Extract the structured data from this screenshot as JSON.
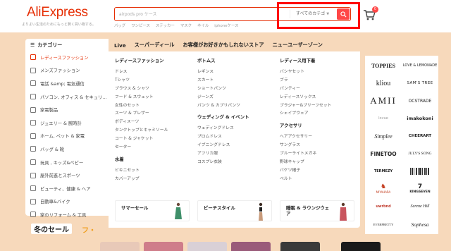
{
  "brand": {
    "logo": "AliExpress",
    "tagline": "よりよい生活のためにもっと賢く買い物する。"
  },
  "search": {
    "placeholder": "airpods pro ケース",
    "category": "すべてのカテゴ",
    "quick_links": [
      "バッグ",
      "ワンピース",
      "ステッカー",
      "マスク",
      "ネイル",
      "iphoneケース"
    ]
  },
  "cart": {
    "count": "0"
  },
  "sidebar": {
    "heading": "カテゴリー",
    "items": [
      {
        "label": "レディースファッション",
        "active": true
      },
      {
        "label": "メンズファッション"
      },
      {
        "label": "電話 &amp; 電気通信"
      },
      {
        "label": "パソコン, オフィス & セキュリ..."
      },
      {
        "label": "家電製品"
      },
      {
        "label": "ジュエリー & 腕時計"
      },
      {
        "label": "ホーム, ペット & 家電"
      },
      {
        "label": "バッグ & 靴"
      },
      {
        "label": "玩具 , キッズ&ベビー"
      },
      {
        "label": "屋外前進とスポーツ"
      },
      {
        "label": "ビューティ、健康 & ヘア"
      },
      {
        "label": "自動車&バイク"
      },
      {
        "label": "家のリフォーム & 工具"
      }
    ]
  },
  "topnav": [
    "Live",
    "スーパーディール",
    "お客様がお好きかもしれないストア",
    "ニューユーザーゾーン"
  ],
  "columns": [
    {
      "sections": [
        {
          "title": "レディースファッション",
          "links": [
            "ドレス",
            "Tシャツ",
            "ブラウス & シャツ",
            "フード & スウェット",
            "女性のセット",
            "スーツ & ブレザー",
            "ボディスーツ",
            "タンクトップとキャミソール",
            "コート & ジャケット",
            "セーター"
          ]
        },
        {
          "title": "水着",
          "links": [
            "ビキニセット",
            "カバーアップ"
          ]
        }
      ]
    },
    {
      "sections": [
        {
          "title": "ボトムス",
          "links": [
            "レギンス",
            "スカート",
            "ショートパンツ",
            "ジーンズ",
            "パンツ & カプリパンツ"
          ]
        },
        {
          "title": "ウェディング & イベント",
          "links": [
            "ウェディングドレス",
            "プロムドレス",
            "イブニングドレス",
            "アフリカ服",
            "コスプレ衣装"
          ]
        }
      ]
    },
    {
      "sections": [
        {
          "title": "レディース用下着",
          "links": [
            "バシヤセット",
            "ブラ",
            "パンティー",
            "レディースソックス",
            "ブラジャー&ブリーフセット",
            "シェイプウェア"
          ]
        },
        {
          "title": "アクセサリ",
          "links": [
            "ヘアアクセサリー",
            "サングラス",
            "ブルーライトメガネ",
            "野球キャップ",
            "バケツ帽子",
            "ベルト"
          ]
        }
      ]
    }
  ],
  "promos": [
    "サマーセール",
    "ビーチスタイル",
    "睡眠 & ラウンジウェア"
  ],
  "brands": [
    "TOPPIES",
    "LOVE & LEMONADE",
    "kliou",
    "SAM'S TREE",
    "AMII",
    "OCSTRADE",
    "lovue",
    "imakokoni",
    "Simplee",
    "CHEERART",
    "FINETOO",
    "JULY'S SONG",
    "TERMEZY",
    "",
    "MIYAHARA",
    "KINGSEVEN",
    "uwrbnd",
    "Serene Hill",
    "EVERPRETTY",
    "Sophesa"
  ],
  "bottom": {
    "title": "冬のセール",
    "deco": "フ・"
  },
  "colors": {
    "accent": "#e62e04",
    "button": "#ff4747",
    "highlight": "#ff0000",
    "background": "#f7d9bb"
  }
}
